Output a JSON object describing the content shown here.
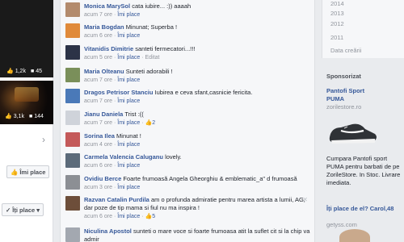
{
  "left": {
    "top_likes": "1,2k",
    "top_comments": "45",
    "mid_likes": "3,1k",
    "mid_comments": "144",
    "like_button_label": "Îmi place",
    "liked_button_label": "Îți place"
  },
  "comments": [
    {
      "author": "Monica MarySol",
      "text": "cata iubire... :)) aaaah",
      "time": "acum 7 ore",
      "action": "Îmi place",
      "likes": ""
    },
    {
      "author": "Maria Bogdan",
      "text": "Minunat;  Superba !",
      "time": "acum 6 ore",
      "action": "Îmi place",
      "likes": ""
    },
    {
      "author": "Vitanidis Dimitrie",
      "text": "santeti fermecatori...!!!",
      "time": "acum 5 ore",
      "action": "Îmi place",
      "extra": "Editat",
      "likes": ""
    },
    {
      "author": "Maria Olteanu",
      "text": "Sunteti adorabili !",
      "time": "acum 7 ore",
      "action": "Îmi place",
      "likes": ""
    },
    {
      "author": "Dragos Petrisor Stanciu",
      "text": "Iubirea e ceva sfant,casnicie fericita.",
      "time": "acum 7 ore",
      "action": "Îmi place",
      "likes": ""
    },
    {
      "author": "Jianu Daniela",
      "text": "Trist :((",
      "time": "acum 7 ore",
      "action": "Îmi place",
      "likes": "2"
    },
    {
      "author": "Sorina Ilea",
      "text": "Minunat !",
      "time": "acum 4 ore",
      "action": "Îmi place",
      "likes": ""
    },
    {
      "author": "Carmela Valencia Caluganu",
      "text": "lovely.",
      "time": "acum 6 ore",
      "action": "Îmi place",
      "likes": ""
    },
    {
      "author": "Ovidiu Berce",
      "text": "Foarte frumoasă Angela Gheorghiu & emblematic_a\" d frumoasă",
      "time": "acum 3 ore",
      "action": "Îmi place",
      "likes": ""
    },
    {
      "author": "Razvan Catalin Purdila",
      "text": "am o profunda admiratie pentru marea artista a lumii, AG, dar poze de tip mama si fiul nu ma inspira !",
      "time": "acum 6 ore",
      "action": "Îmi place",
      "likes": "5"
    },
    {
      "author": "Niculina Apostol",
      "text": "sunteti o mare voce si foarte frumoasa atit la suflet cit si la chip va admir",
      "time": "",
      "action": "",
      "likes": ""
    }
  ],
  "right": {
    "years": [
      "2014",
      "2013",
      "2012",
      "2011",
      "Data creării"
    ],
    "sponsored_label": "Sponsorizat",
    "ad_title": "Pantofi Sport PUMA",
    "ad_domain": "zorilestore.ro",
    "ad_text": "Cumpara Pantofi sport PUMA pentru barbati de pe ZorileStore. In Stoc. Livrare imediata.",
    "ad2_title": "Îți place de el? Carol,48",
    "ad2_domain": "getyss.com"
  },
  "colors": {
    "link": "#365899",
    "meta": "#90949c",
    "like_blue": "#5890ff",
    "background": "#e9ebee"
  }
}
